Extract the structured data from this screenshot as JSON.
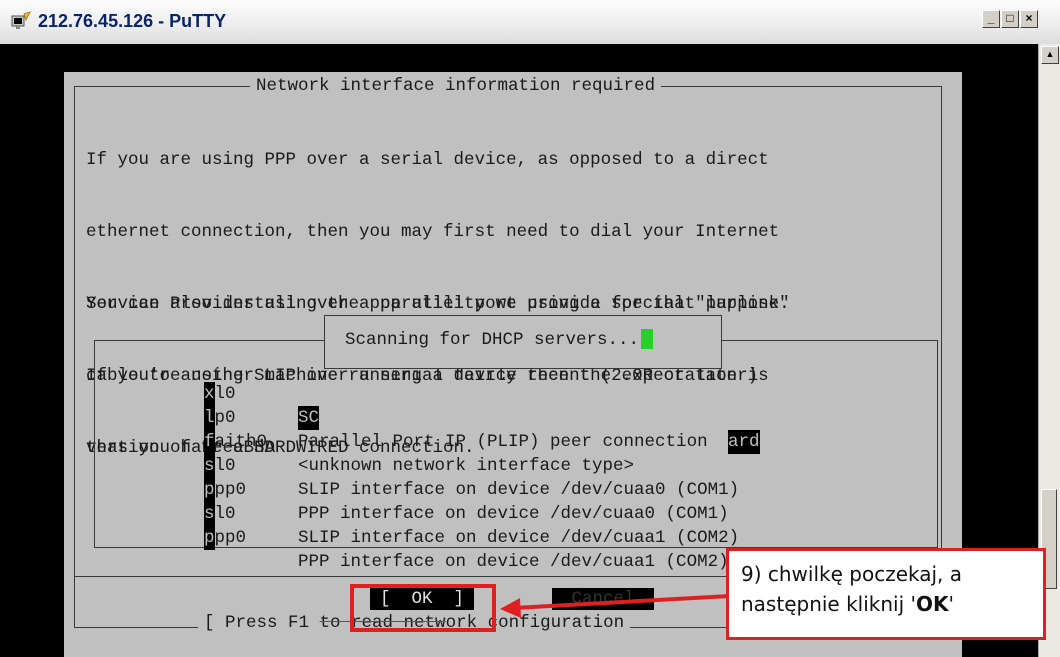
{
  "window": {
    "title": "212.76.45.126 - PuTTY",
    "controls": {
      "minimize": "_",
      "maximize": "□",
      "close": "×"
    }
  },
  "dialog": {
    "title": "Network interface information required",
    "paragraph1": [
      "If you are using PPP over a serial device, as opposed to a direct",
      "ethernet connection, then you may first need to dial your Internet",
      "Service Provider using the ppp utility we provide for that purpose.",
      "If you're using SLIP over a serial device then the expectation is",
      "that you have a HARDWIRED connection."
    ],
    "paragraph2": [
      "You can also install over a parallel port using a special \"laplink\"",
      "cable to another machine running a fairly recent (2.0R or later)",
      "version of FreeBSD"
    ],
    "interfaces": [
      {
        "hot": "x",
        "rest": "l0",
        "desc_head": "SC",
        "desc_tail": "ard"
      },
      {
        "hot": "l",
        "rest": "p0",
        "desc": "Parallel Port IP (PLIP) peer connection"
      },
      {
        "hot": "f",
        "rest": "aith0",
        "desc": "<unknown network interface type>"
      },
      {
        "hot": "s",
        "rest": "l0",
        "desc": "SLIP interface on device /dev/cuaa0 (COM1)"
      },
      {
        "hot": "p",
        "rest": "pp0",
        "desc": "PPP interface on device /dev/cuaa0 (COM1)"
      },
      {
        "hot": "s",
        "rest": "l0",
        "desc": "SLIP interface on device /dev/cuaa1 (COM2)"
      },
      {
        "hot": "p",
        "rest": "pp0",
        "desc": "PPP interface on device /dev/cuaa1 (COM2)"
      }
    ],
    "popup": "Scanning for DHCP servers...",
    "ok_label": "[  OK  ]",
    "cancel_label": "Cancel",
    "hint_prefix": "[ Press F1 ",
    "hint_struck": "to read netw",
    "hint_suffix": "ork configuration"
  },
  "callout": {
    "line1": "9) chwilkę poczekaj, a",
    "line2_prefix": "następnie kliknij '",
    "line2_bold": "OK",
    "line2_suffix": "'"
  },
  "colors": {
    "annotation": "#e02020",
    "cursor": "#2ad02a",
    "dialog_bg": "#c0c0c0"
  }
}
